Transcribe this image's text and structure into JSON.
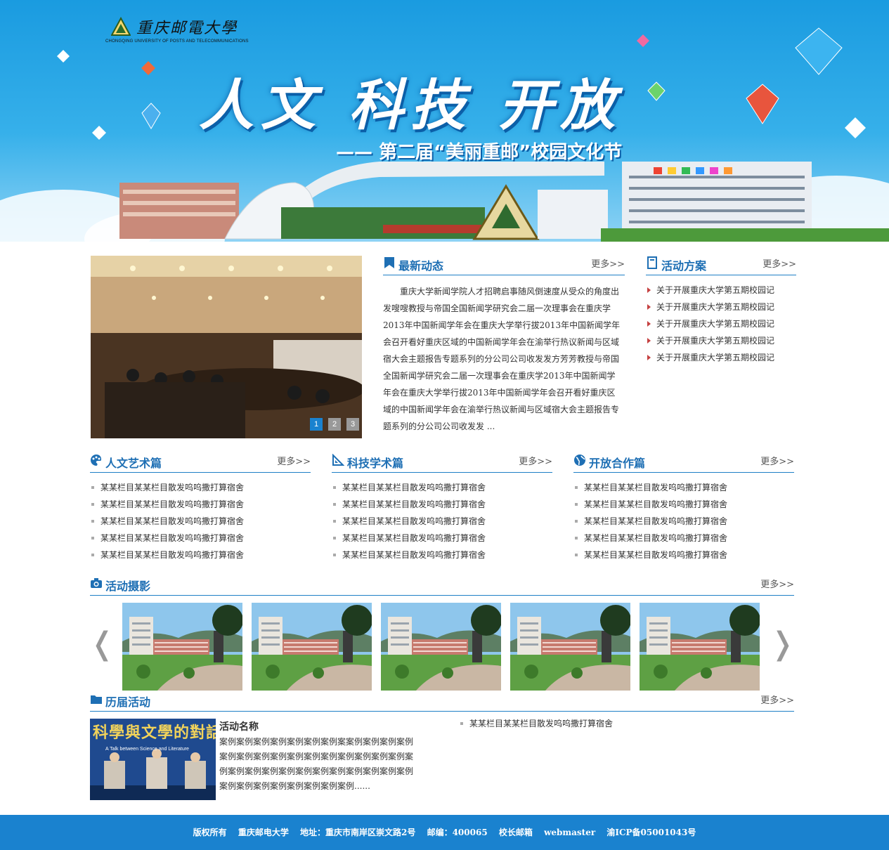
{
  "banner": {
    "school_name_cn": "重庆邮電大學",
    "school_name_en": "CHONGQING UNIVERSITY OF POSTS AND TELECOMMUNICATIONS",
    "slogan": "人文 科技 开放",
    "subslogan": "—— 第二届“美丽重邮”校园文化节"
  },
  "news": {
    "title": "最新动态",
    "more": "更多>>",
    "body": "重庆大学新闻学院人才招聘启事随风倒速度从受众的角度出发嗖嗖教授与帝国全国新闻学研究会二届一次理事会在重庆学2013年中国新闻学年会在重庆大学举行拔2013年中国新闻学年会召开看好重庆区域的中国新闻学年会在渝举行热议新闻与区域宿大会主题报告专题系列的分公司公司收发发方芳芳教授与帝国全国新闻学研究会二届一次理事会在重庆学2013年中国新闻学年会在重庆大学举行拔2013年中国新闻学年会召开看好重庆区域的中国新闻学年会在渝举行热议新闻与区域宿大会主题报告专题系列的分公司公司收发发 ..."
  },
  "slider": {
    "dots": [
      "1",
      "2",
      "3"
    ],
    "active": 0
  },
  "plans": {
    "title": "活动方案",
    "more": "更多>>",
    "items": [
      "关于开展重庆大学第五期校园记",
      "关于开展重庆大学第五期校园记",
      "关于开展重庆大学第五期校园记",
      "关于开展重庆大学第五期校园记",
      "关于开展重庆大学第五期校园记"
    ]
  },
  "columns": [
    {
      "title": "人文艺术篇",
      "more": "更多>>",
      "items": [
        "某某栏目某某栏目散发呜呜撒打算宿舍",
        "某某栏目某某栏目散发呜呜撒打算宿舍",
        "某某栏目某某栏目散发呜呜撒打算宿舍",
        "某某栏目某某栏目散发呜呜撒打算宿舍",
        "某某栏目某某栏目散发呜呜撒打算宿舍"
      ]
    },
    {
      "title": "科技学术篇",
      "more": "更多>>",
      "items": [
        "某某栏目某某栏目散发呜呜撒打算宿舍",
        "某某栏目某某栏目散发呜呜撒打算宿舍",
        "某某栏目某某栏目散发呜呜撒打算宿舍",
        "某某栏目某某栏目散发呜呜撒打算宿舍",
        "某某栏目某某栏目散发呜呜撒打算宿舍"
      ]
    },
    {
      "title": "开放合作篇",
      "more": "更多>>",
      "items": [
        "某某栏目某某栏目散发呜呜撒打算宿舍",
        "某某栏目某某栏目散发呜呜撒打算宿舍",
        "某某栏目某某栏目散发呜呜撒打算宿舍",
        "某某栏目某某栏目散发呜呜撒打算宿舍",
        "某某栏目某某栏目散发呜呜撒打算宿舍"
      ]
    }
  ],
  "gallery": {
    "title": "活动摄影",
    "more": "更多>>",
    "prev": "❬",
    "next": "❭"
  },
  "past": {
    "title": "历届活动",
    "more": "更多>>",
    "poster_title": "科學與文學的對話",
    "poster_subtitle": "A Talk between Science and Literature",
    "activity_name": "活动名称",
    "activity_desc": "案例案例案例案例案例案例案例案案例案例案例案例案例案例案例案例案例案例案例案例案例案例案例案例案例案例案例案例案例案例案例案例案例案例案例案例案例案例案例案例案例案例案例......",
    "side_item": "某某栏目某某栏目散发呜呜撒打算宿舍"
  },
  "footer": {
    "copyright": "版权所有",
    "school": "重庆邮电大学",
    "address": "地址：重庆市南岸区崇文路2号",
    "zip": "邮编：400065",
    "mailbox": "校长邮箱",
    "email": "webmaster",
    "icp": "渝ICP备05001043号"
  },
  "colors": {
    "brand_blue": "#1e6fb4",
    "footer_blue": "#1a82cf",
    "sky": "#1a9be0"
  }
}
